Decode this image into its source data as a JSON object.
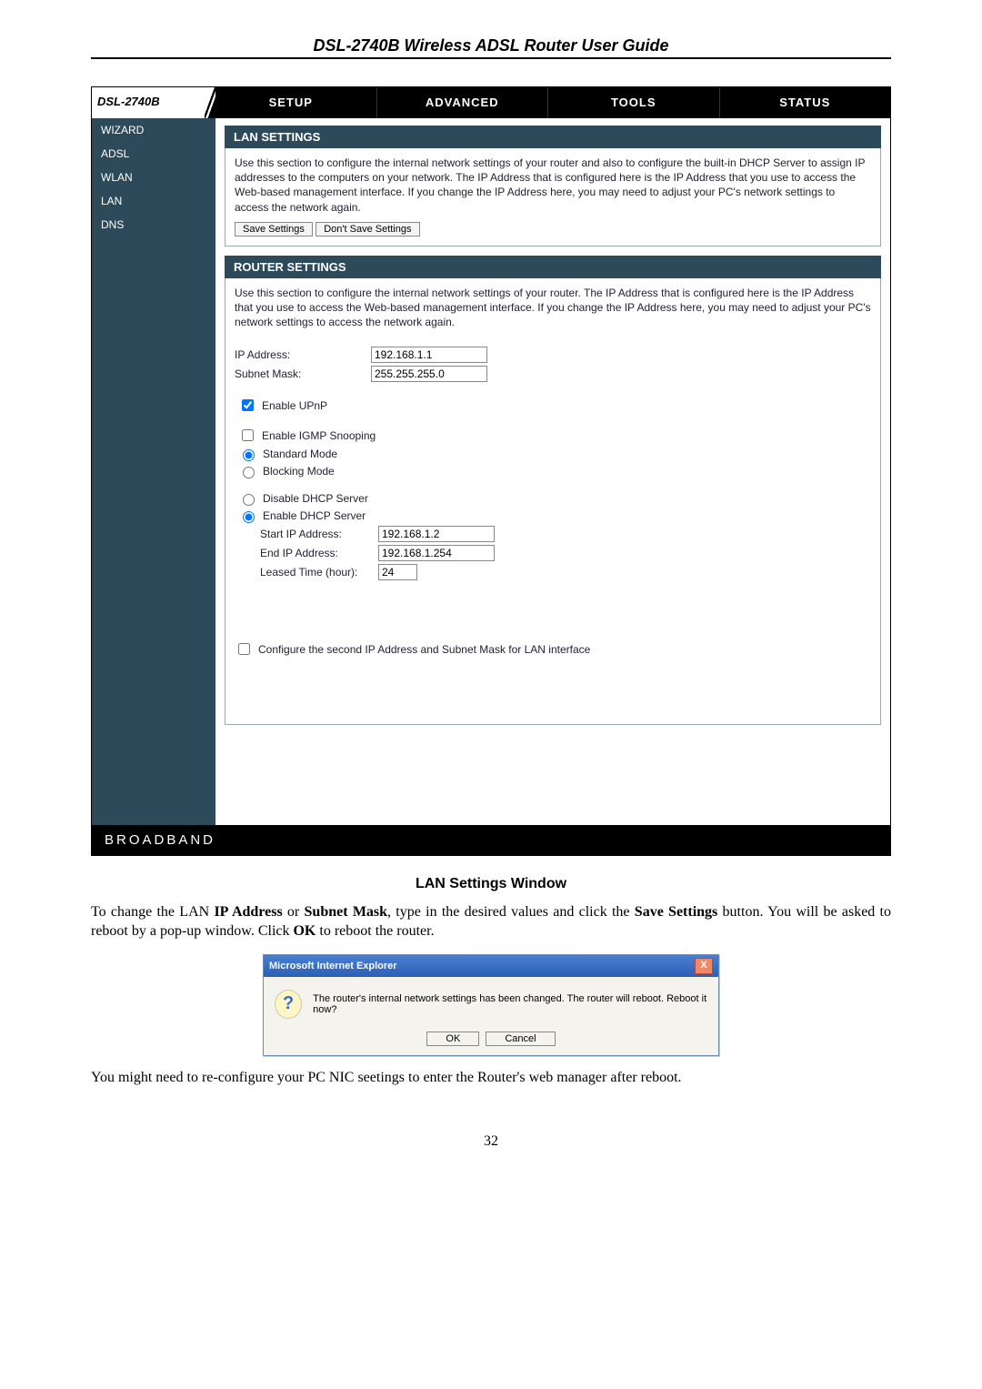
{
  "guide_title": "DSL-2740B Wireless ADSL Router User Guide",
  "model": "DSL-2740B",
  "tabs": {
    "setup": "SETUP",
    "advanced": "ADVANCED",
    "tools": "TOOLS",
    "status": "STATUS"
  },
  "sidebar": {
    "wizard": "WIZARD",
    "adsl": "ADSL",
    "wlan": "WLAN",
    "lan": "LAN",
    "dns": "DNS"
  },
  "lan_settings": {
    "heading": "LAN SETTINGS",
    "desc": "Use this section to configure the internal network settings of your router and also to configure the built-in DHCP Server to assign IP addresses to the computers on your network. The IP Address that is configured here is the IP Address that you use to access the Web-based management interface. If you change the IP Address here, you may need to adjust your PC's network settings to access the network again.",
    "save": "Save Settings",
    "dont_save": "Don't Save Settings"
  },
  "router_settings": {
    "heading": "ROUTER SETTINGS",
    "desc": "Use this section to configure the internal network settings of your router. The IP Address that is configured here is the IP Address that you use to access the Web-based management interface. If you change the IP Address here, you may need to adjust your PC's network settings to access the network again.",
    "ip_label": "IP Address:",
    "ip_value": "192.168.1.1",
    "mask_label": "Subnet Mask:",
    "mask_value": "255.255.255.0",
    "enable_upnp": "Enable UPnP",
    "enable_igmp": "Enable IGMP Snooping",
    "standard_mode": "Standard Mode",
    "blocking_mode": "Blocking Mode",
    "disable_dhcp": "Disable DHCP Server",
    "enable_dhcp": "Enable DHCP Server",
    "start_ip_label": "Start IP Address:",
    "start_ip_value": "192.168.1.2",
    "end_ip_label": "End IP Address:",
    "end_ip_value": "192.168.1.254",
    "leased_label": "Leased Time (hour):",
    "leased_value": "24",
    "second_ip": "Configure the second IP Address and Subnet Mask for LAN interface"
  },
  "footer_brand": "BROADBAND",
  "caption": "LAN Settings Window",
  "para1_a": "To change the LAN ",
  "para1_b": "IP Address",
  "para1_c": " or ",
  "para1_d": "Subnet Mask",
  "para1_e": ", type in the desired values and click the ",
  "para1_f": "Save Settings",
  "para1_g": " button. You will be asked to reboot by a pop-up window.  Click ",
  "para1_h": "OK",
  "para1_i": " to reboot the router.",
  "dialog": {
    "title": "Microsoft Internet Explorer",
    "msg": "The router's internal network settings has been changed. The router will reboot. Reboot it now?",
    "ok": "OK",
    "cancel": "Cancel",
    "close": "X"
  },
  "para2": "You might need to re-configure your PC NIC seetings to enter the Router's web manager after reboot.",
  "page_num": "32"
}
